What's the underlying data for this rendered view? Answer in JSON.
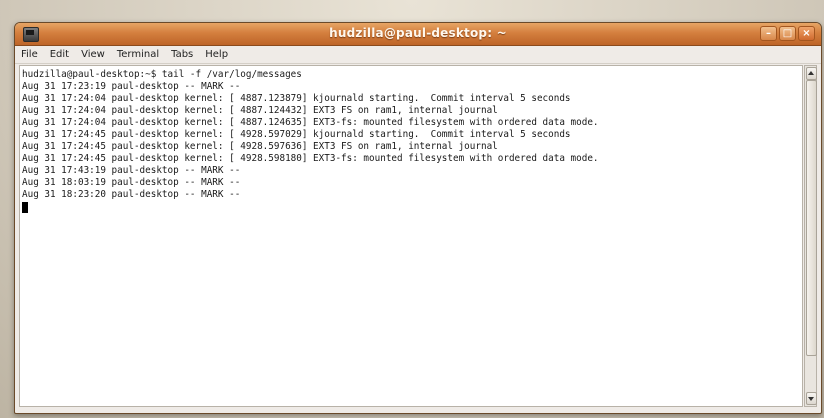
{
  "window": {
    "title": "hudzilla@paul-desktop: ~",
    "icon": "terminal-icon",
    "buttons": {
      "minimize_glyph": "–",
      "maximize_glyph": "□",
      "close_glyph": "×"
    },
    "colors": {
      "titlebar": "#d47f3e",
      "terminal_bg": "#ffffff",
      "text": "#1a1a1a"
    }
  },
  "menubar": {
    "items": [
      "File",
      "Edit",
      "View",
      "Terminal",
      "Tabs",
      "Help"
    ]
  },
  "terminal": {
    "lines": [
      "hudzilla@paul-desktop:~$ tail -f /var/log/messages",
      "Aug 31 17:23:19 paul-desktop -- MARK --",
      "Aug 31 17:24:04 paul-desktop kernel: [ 4887.123879] kjournald starting.  Commit interval 5 seconds",
      "Aug 31 17:24:04 paul-desktop kernel: [ 4887.124432] EXT3 FS on ram1, internal journal",
      "Aug 31 17:24:04 paul-desktop kernel: [ 4887.124635] EXT3-fs: mounted filesystem with ordered data mode.",
      "Aug 31 17:24:45 paul-desktop kernel: [ 4928.597029] kjournald starting.  Commit interval 5 seconds",
      "Aug 31 17:24:45 paul-desktop kernel: [ 4928.597636] EXT3 FS on ram1, internal journal",
      "Aug 31 17:24:45 paul-desktop kernel: [ 4928.598180] EXT3-fs: mounted filesystem with ordered data mode.",
      "Aug 31 17:43:19 paul-desktop -- MARK --",
      "Aug 31 18:03:19 paul-desktop -- MARK --",
      "Aug 31 18:23:20 paul-desktop -- MARK --"
    ]
  }
}
